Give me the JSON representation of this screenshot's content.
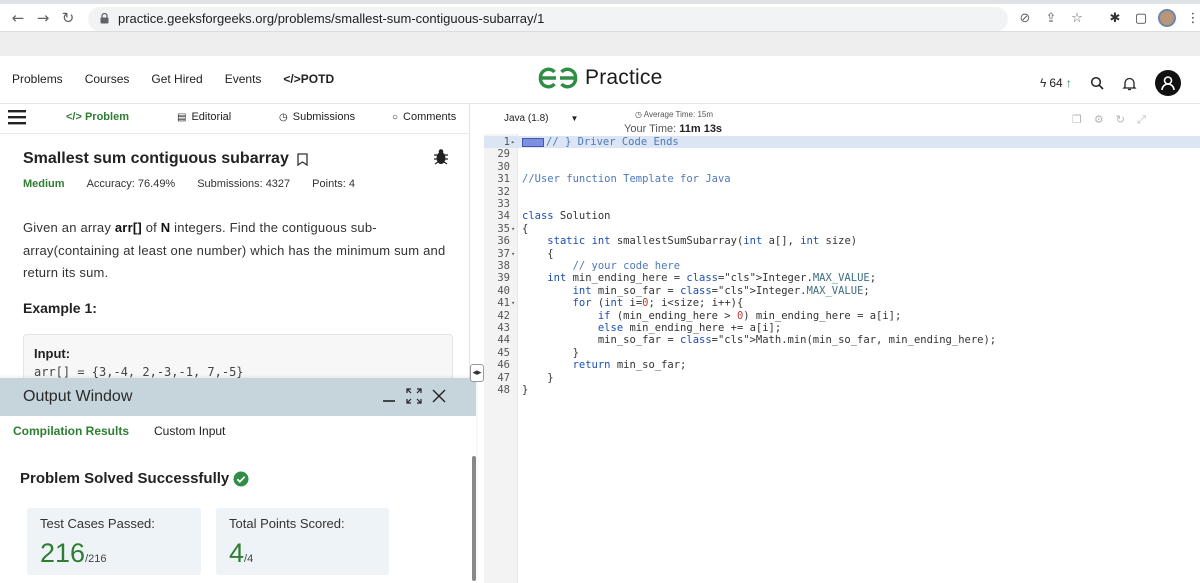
{
  "browser": {
    "url": "practice.geeksforgeeks.org/problems/smallest-sum-contiguous-subarray/1"
  },
  "site": {
    "nav": [
      "Problems",
      "Courses",
      "Get Hired",
      "Events",
      "</>POTD"
    ],
    "logo_text": "Practice",
    "streak": "64",
    "brand_color": "#2f8d46"
  },
  "left_tabs": [
    "</> Problem",
    "Editorial",
    "Submissions",
    "Comments"
  ],
  "problem": {
    "title": "Smallest sum contiguous subarray",
    "difficulty": "Medium",
    "accuracy": "Accuracy: 76.49%",
    "submissions": "Submissions: 4327",
    "points": "Points: 4",
    "desc_1": "Given an array ",
    "desc_arr": "arr[]",
    "desc_2": " of ",
    "desc_n": "N",
    "desc_3": " integers. Find the contiguous sub-array(containing at least one number) which has the minimum sum and return its sum.",
    "example_title": "Example 1:",
    "input_label": "Input:",
    "input_value": "arr[] = {3,-4, 2,-3,-1, 7,-5}"
  },
  "output": {
    "title": "Output Window",
    "tabs": [
      "Compilation Results",
      "Custom Input"
    ],
    "status": "Problem Solved Successfully",
    "tests_label": "Test Cases Passed:",
    "tests_value": "216",
    "tests_total": "/216",
    "points_label": "Total Points Scored:",
    "points_value": "4",
    "points_total": "/4"
  },
  "editor": {
    "language": "Java (1.8)",
    "avg_time": "Average Time: 15m",
    "your_time_label": "Your Time: ",
    "your_time": "11m 13s",
    "lines": [
      {
        "n": "1",
        "fold": "▸",
        "text": "// } Driver Code Ends",
        "hl": true
      },
      {
        "n": "29",
        "fold": "",
        "text": ""
      },
      {
        "n": "30",
        "fold": "",
        "text": ""
      },
      {
        "n": "31",
        "fold": "",
        "text": "//User function Template for Java"
      },
      {
        "n": "32",
        "fold": "",
        "text": ""
      },
      {
        "n": "33",
        "fold": "",
        "text": ""
      },
      {
        "n": "34",
        "fold": "",
        "text": "class Solution"
      },
      {
        "n": "35",
        "fold": "▾",
        "text": "{"
      },
      {
        "n": "36",
        "fold": "",
        "text": "    static int smallestSumSubarray(int a[], int size)"
      },
      {
        "n": "37",
        "fold": "▾",
        "text": "    {"
      },
      {
        "n": "38",
        "fold": "",
        "text": "        // your code here"
      },
      {
        "n": "39",
        "fold": "",
        "text": "    int min_ending_here = Integer.MAX_VALUE;"
      },
      {
        "n": "40",
        "fold": "",
        "text": "        int min_so_far = Integer.MAX_VALUE;"
      },
      {
        "n": "41",
        "fold": "▾",
        "text": "        for (int i=0; i<size; i++){"
      },
      {
        "n": "42",
        "fold": "",
        "text": "            if (min_ending_here > 0) min_ending_here = a[i];"
      },
      {
        "n": "43",
        "fold": "",
        "text": "            else min_ending_here += a[i];"
      },
      {
        "n": "44",
        "fold": "",
        "text": "            min_so_far = Math.min(min_so_far, min_ending_here);"
      },
      {
        "n": "45",
        "fold": "",
        "text": "        }"
      },
      {
        "n": "46",
        "fold": "",
        "text": "        return min_so_far;"
      },
      {
        "n": "47",
        "fold": "",
        "text": "    }"
      },
      {
        "n": "48",
        "fold": "",
        "text": "}"
      }
    ]
  }
}
